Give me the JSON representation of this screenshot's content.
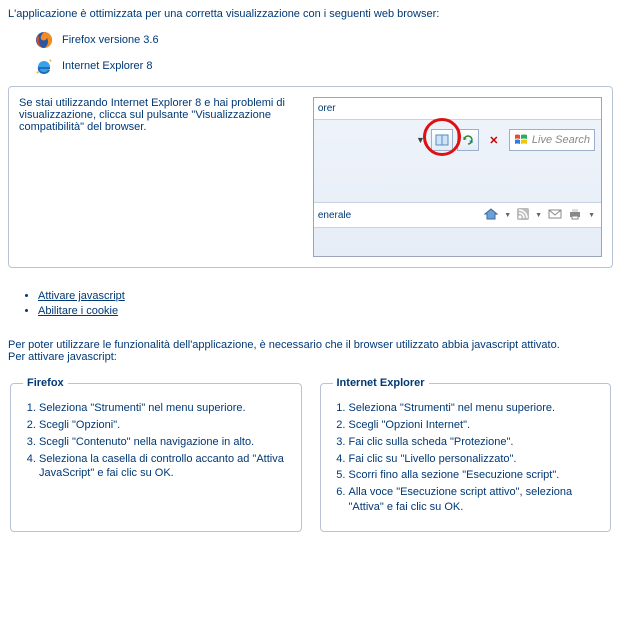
{
  "intro": "L'applicazione è ottimizzata per una corretta visualizzazione con i seguenti web browser:",
  "browsers": {
    "firefox": "Firefox versione 3.6",
    "ie": "Internet Explorer 8"
  },
  "compat_box": {
    "text": "Se stai utilizzando Internet Explorer 8 e hai problemi di visualizzazione, clicca sul pulsante \"Visualizzazione compatibilità\" del browser.",
    "mock": {
      "title_fragment": "orer",
      "tab_label": "enerale",
      "search_placeholder": "Live Search"
    }
  },
  "links": {
    "js": "Attivare javascript",
    "cookie": "Abilitare i cookie"
  },
  "js_section": {
    "para1": "Per poter utilizzare le funzionalità dell'applicazione, è necessario che il browser utilizzato abbia javascript attivato.",
    "para2": "Per attivare javascript:",
    "firefox": {
      "title": "Firefox",
      "steps": [
        "Seleziona \"Strumenti\" nel menu superiore.",
        "Scegli \"Opzioni\".",
        "Scegli \"Contenuto\" nella navigazione in alto.",
        "Seleziona la casella di controllo accanto ad \"Attiva JavaScript\" e fai clic su OK."
      ]
    },
    "ie": {
      "title": "Internet Explorer",
      "steps": [
        "Seleziona \"Strumenti\" nel menu superiore.",
        "Scegli \"Opzioni Internet\".",
        "Fai clic sulla scheda \"Protezione\".",
        "Fai clic su \"Livello personalizzato\".",
        "Scorri fino alla sezione \"Esecuzione script\".",
        "Alla voce \"Esecuzione script attivo\", seleziona \"Attiva\" e fai clic su OK."
      ]
    }
  }
}
